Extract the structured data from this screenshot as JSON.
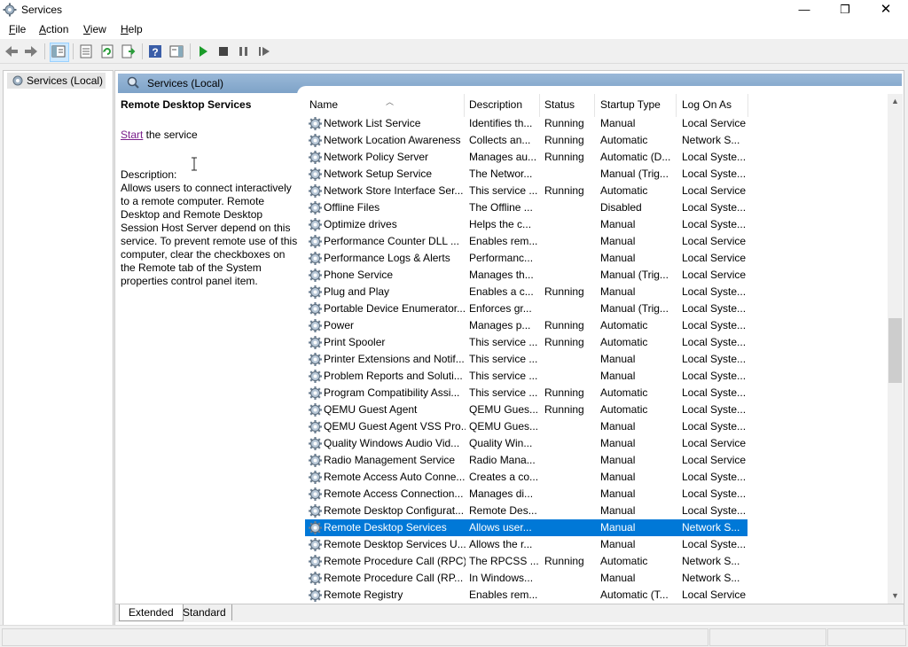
{
  "window": {
    "title": "Services",
    "minimize": "—",
    "maximize": "❐",
    "close": "✕"
  },
  "menu": [
    {
      "label": "File",
      "ul": "F",
      "rest": "ile"
    },
    {
      "label": "Action",
      "ul": "A",
      "rest": "ction"
    },
    {
      "label": "View",
      "ul": "V",
      "rest": "iew"
    },
    {
      "label": "Help",
      "ul": "H",
      "rest": "elp"
    }
  ],
  "toolbar": {
    "icons": [
      "back-icon",
      "forward-icon",
      "show-hide-console-tree-icon",
      "properties-icon",
      "refresh-icon",
      "export-list-icon",
      "help-icon",
      "show-hide-action-pane-icon",
      "start-service-icon",
      "stop-service-icon",
      "pause-service-icon",
      "restart-service-icon"
    ]
  },
  "tree": {
    "item": "Services (Local)"
  },
  "main": {
    "header": "Services (Local)"
  },
  "description": {
    "title": "Remote Desktop Services",
    "start_link": "Start",
    "start_rest": " the service",
    "label": "Description:",
    "text": "Allows users to connect interactively to a remote computer. Remote Desktop and Remote Desktop Session Host Server depend on this service. To prevent remote use of this computer, clear the checkboxes on the Remote tab of the System properties control panel item."
  },
  "columns": {
    "name": "Name",
    "description": "Description",
    "status": "Status",
    "startup_type": "Startup Type",
    "log_on_as": "Log On As"
  },
  "services": [
    {
      "name": "Network List Service",
      "description": "Identifies th...",
      "status": "Running",
      "startup_type": "Manual",
      "log_on_as": "Local Service"
    },
    {
      "name": "Network Location Awareness",
      "description": "Collects an...",
      "status": "Running",
      "startup_type": "Automatic",
      "log_on_as": "Network S..."
    },
    {
      "name": "Network Policy Server",
      "description": "Manages au...",
      "status": "Running",
      "startup_type": "Automatic (D...",
      "log_on_as": "Local Syste..."
    },
    {
      "name": "Network Setup Service",
      "description": "The Networ...",
      "status": "",
      "startup_type": "Manual (Trig...",
      "log_on_as": "Local Syste..."
    },
    {
      "name": "Network Store Interface Ser...",
      "description": "This service ...",
      "status": "Running",
      "startup_type": "Automatic",
      "log_on_as": "Local Service"
    },
    {
      "name": "Offline Files",
      "description": "The Offline ...",
      "status": "",
      "startup_type": "Disabled",
      "log_on_as": "Local Syste..."
    },
    {
      "name": "Optimize drives",
      "description": "Helps the c...",
      "status": "",
      "startup_type": "Manual",
      "log_on_as": "Local Syste..."
    },
    {
      "name": "Performance Counter DLL ...",
      "description": "Enables rem...",
      "status": "",
      "startup_type": "Manual",
      "log_on_as": "Local Service"
    },
    {
      "name": "Performance Logs & Alerts",
      "description": "Performanc...",
      "status": "",
      "startup_type": "Manual",
      "log_on_as": "Local Service"
    },
    {
      "name": "Phone Service",
      "description": "Manages th...",
      "status": "",
      "startup_type": "Manual (Trig...",
      "log_on_as": "Local Service"
    },
    {
      "name": "Plug and Play",
      "description": "Enables a c...",
      "status": "Running",
      "startup_type": "Manual",
      "log_on_as": "Local Syste..."
    },
    {
      "name": "Portable Device Enumerator...",
      "description": "Enforces gr...",
      "status": "",
      "startup_type": "Manual (Trig...",
      "log_on_as": "Local Syste..."
    },
    {
      "name": "Power",
      "description": "Manages p...",
      "status": "Running",
      "startup_type": "Automatic",
      "log_on_as": "Local Syste..."
    },
    {
      "name": "Print Spooler",
      "description": "This service ...",
      "status": "Running",
      "startup_type": "Automatic",
      "log_on_as": "Local Syste..."
    },
    {
      "name": "Printer Extensions and Notif...",
      "description": "This service ...",
      "status": "",
      "startup_type": "Manual",
      "log_on_as": "Local Syste..."
    },
    {
      "name": "Problem Reports and Soluti...",
      "description": "This service ...",
      "status": "",
      "startup_type": "Manual",
      "log_on_as": "Local Syste..."
    },
    {
      "name": "Program Compatibility Assi...",
      "description": "This service ...",
      "status": "Running",
      "startup_type": "Automatic",
      "log_on_as": "Local Syste..."
    },
    {
      "name": "QEMU Guest Agent",
      "description": "QEMU Gues...",
      "status": "Running",
      "startup_type": "Automatic",
      "log_on_as": "Local Syste..."
    },
    {
      "name": "QEMU Guest Agent VSS Pro...",
      "description": "QEMU Gues...",
      "status": "",
      "startup_type": "Manual",
      "log_on_as": "Local Syste..."
    },
    {
      "name": "Quality Windows Audio Vid...",
      "description": "Quality Win...",
      "status": "",
      "startup_type": "Manual",
      "log_on_as": "Local Service"
    },
    {
      "name": "Radio Management Service",
      "description": "Radio Mana...",
      "status": "",
      "startup_type": "Manual",
      "log_on_as": "Local Service"
    },
    {
      "name": "Remote Access Auto Conne...",
      "description": "Creates a co...",
      "status": "",
      "startup_type": "Manual",
      "log_on_as": "Local Syste..."
    },
    {
      "name": "Remote Access Connection...",
      "description": "Manages di...",
      "status": "",
      "startup_type": "Manual",
      "log_on_as": "Local Syste..."
    },
    {
      "name": "Remote Desktop Configurat...",
      "description": "Remote Des...",
      "status": "",
      "startup_type": "Manual",
      "log_on_as": "Local Syste..."
    },
    {
      "name": "Remote Desktop Services",
      "description": "Allows user...",
      "status": "",
      "startup_type": "Manual",
      "log_on_as": "Network S...",
      "selected": true
    },
    {
      "name": "Remote Desktop Services U...",
      "description": "Allows the r...",
      "status": "",
      "startup_type": "Manual",
      "log_on_as": "Local Syste..."
    },
    {
      "name": "Remote Procedure Call (RPC)",
      "description": "The RPCSS ...",
      "status": "Running",
      "startup_type": "Automatic",
      "log_on_as": "Network S..."
    },
    {
      "name": "Remote Procedure Call (RP...",
      "description": "In Windows...",
      "status": "",
      "startup_type": "Manual",
      "log_on_as": "Network S..."
    },
    {
      "name": "Remote Registry",
      "description": "Enables rem...",
      "status": "",
      "startup_type": "Automatic (T...",
      "log_on_as": "Local Service"
    }
  ],
  "tabs": {
    "extended": "Extended",
    "standard": "Standard"
  },
  "colors": {
    "selection": "#0078d7",
    "header_band": "#8fb0d2",
    "link": "#7a1f8b"
  }
}
